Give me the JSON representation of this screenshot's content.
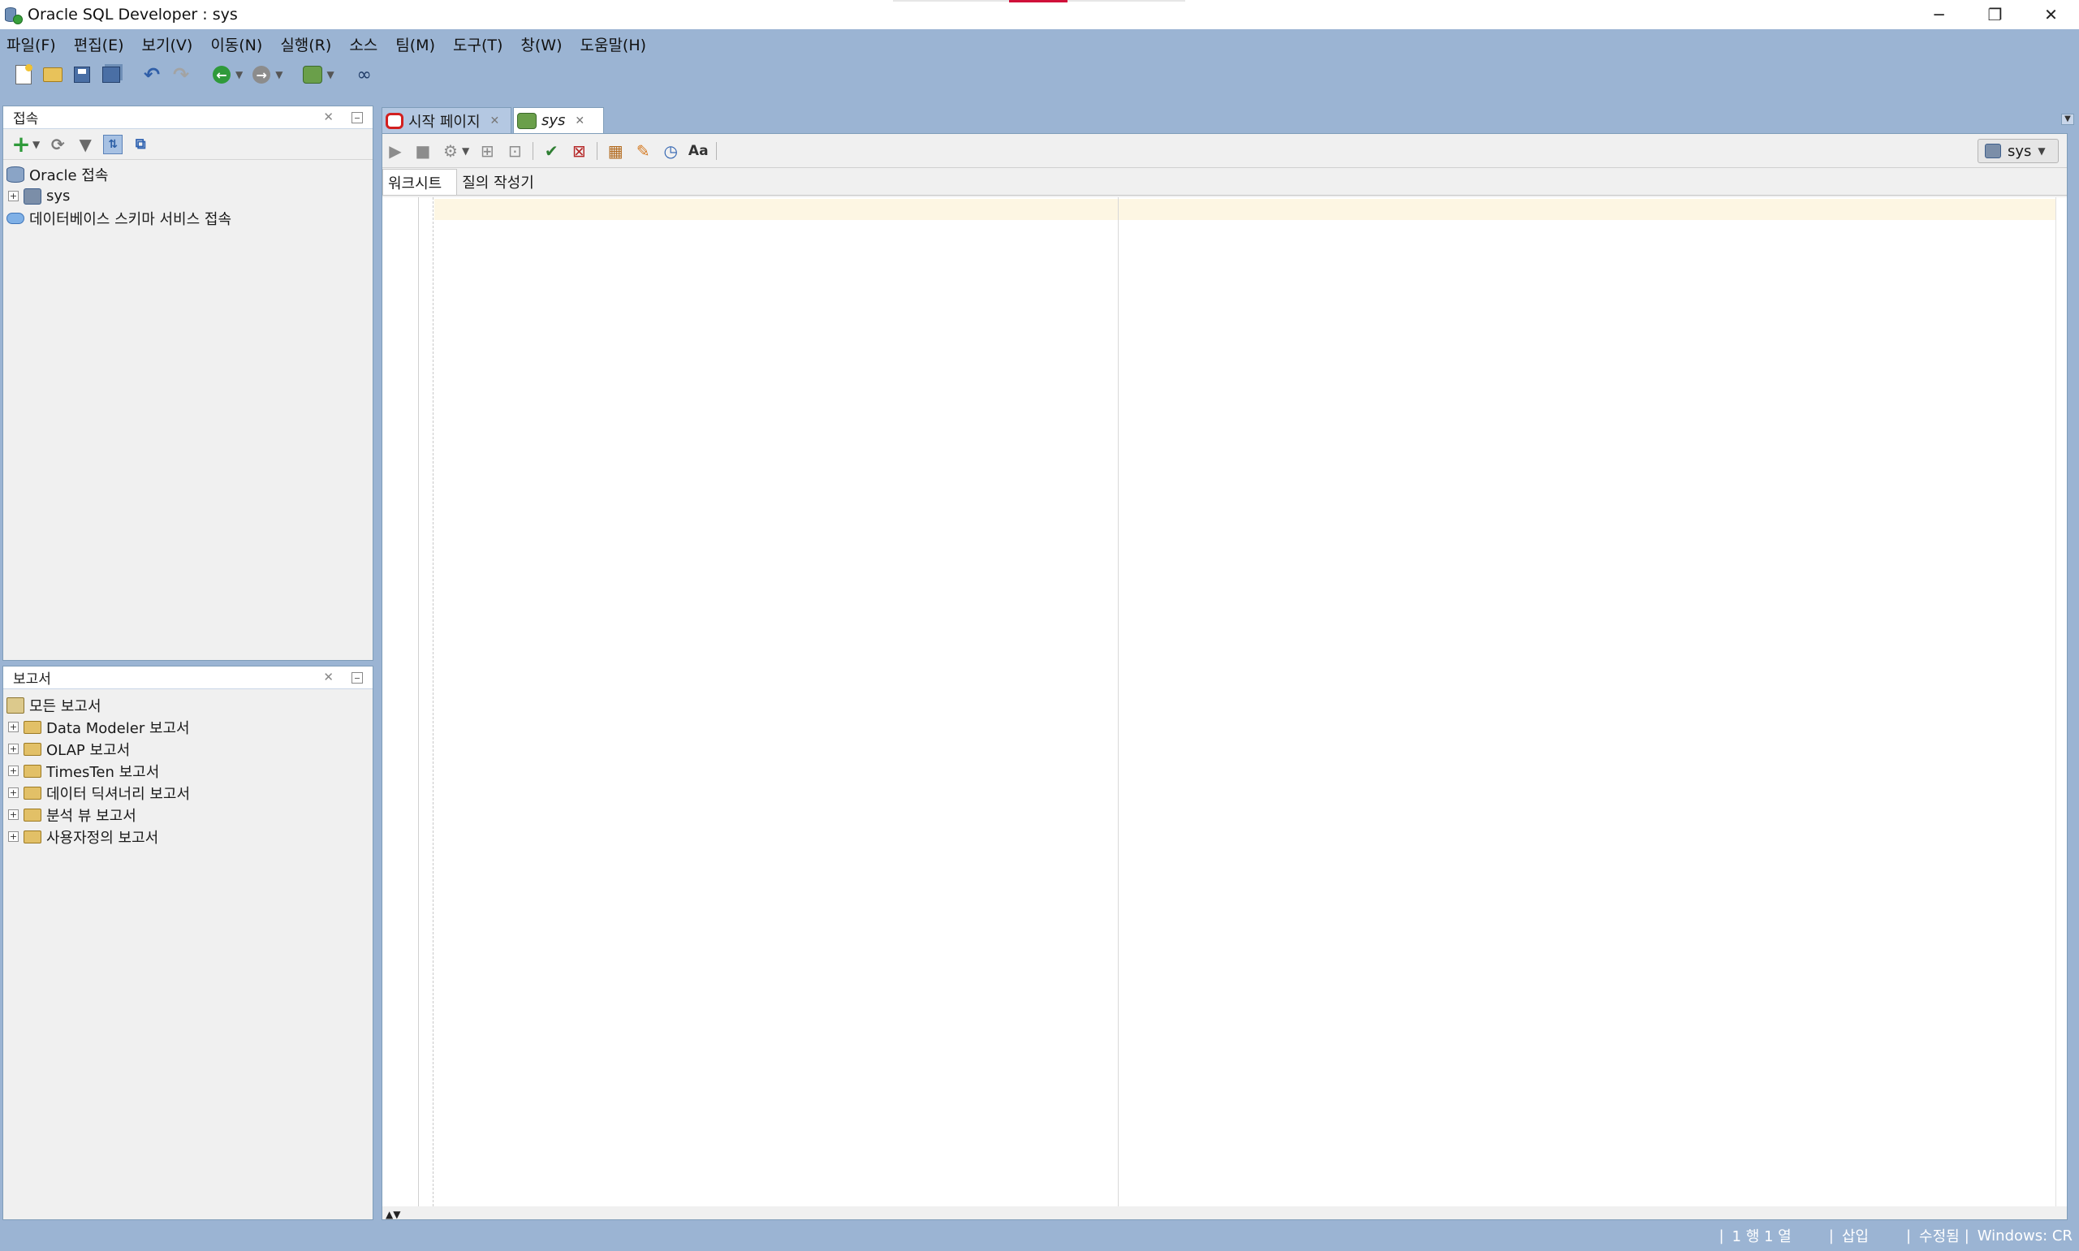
{
  "window": {
    "title": "Oracle SQL Developer : sys",
    "controls": [
      "─",
      "❐",
      "✕"
    ]
  },
  "menu": {
    "items": [
      "파일(F)",
      "편집(E)",
      "보기(V)",
      "이동(N)",
      "실행(R)",
      "소스",
      "팀(M)",
      "도구(T)",
      "창(W)",
      "도움말(H)"
    ]
  },
  "connections_panel": {
    "title": "접속",
    "tree": {
      "root": "Oracle 접속",
      "sys": "sys",
      "schema_service": "데이터베이스 스키마 서비스 접속"
    }
  },
  "reports_panel": {
    "title": "보고서",
    "tree": {
      "root": "모든 보고서",
      "items": [
        "Data Modeler 보고서",
        "OLAP 보고서",
        "TimesTen 보고서",
        "데이터 딕셔너리 보고서",
        "분석 뷰 보고서",
        "사용자정의 보고서"
      ]
    }
  },
  "editor": {
    "tabs": {
      "start_page": "시작 페이지",
      "sys": "sys"
    },
    "subtabs": {
      "worksheet": "워크시트",
      "query_builder": "질의 작성기"
    },
    "connection": "sys"
  },
  "status": {
    "position": "1 행 1 열",
    "mode": "삽입",
    "modified": "수정됨",
    "line_endings": "Windows: CR"
  },
  "icons": {
    "toolbar": [
      "new-file-icon",
      "open-folder-icon",
      "save-icon",
      "save-all-icon",
      "undo-icon",
      "redo-icon",
      "back-icon",
      "forward-icon",
      "sql-worksheet-icon",
      "find-db-object-icon"
    ],
    "editor_toolbar": [
      "run-statement-icon",
      "stop-icon",
      "run-script-icon",
      "autotrace-icon",
      "explain-plan-icon",
      "commit-icon",
      "rollback-icon",
      "sql-tuning-icon",
      "clear-icon",
      "sql-history-icon",
      "case-format-icon"
    ]
  }
}
